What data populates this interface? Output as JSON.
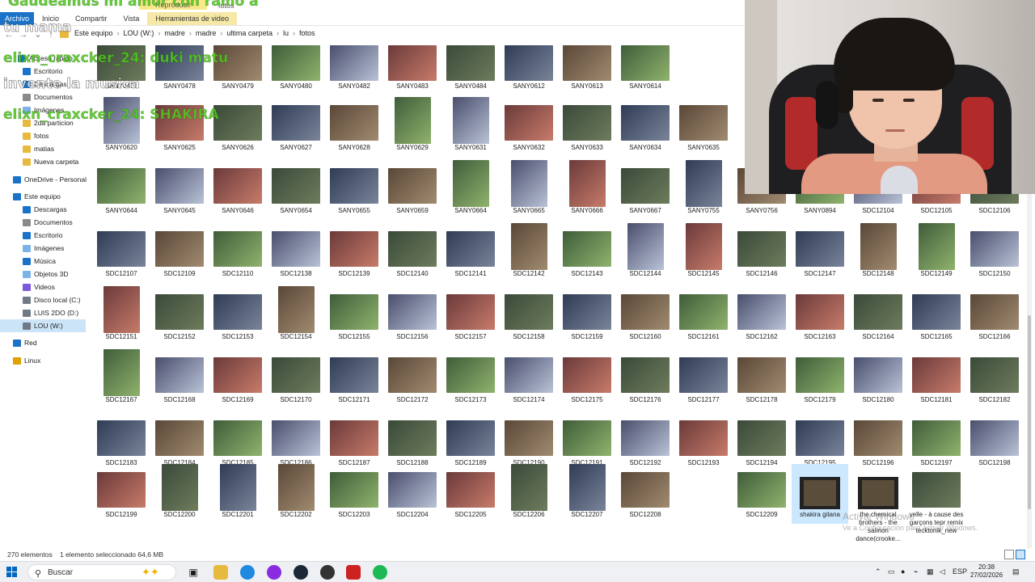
{
  "ribbon": {
    "tabs": [
      "Archivo",
      "Inicio",
      "Compartir",
      "Vista",
      "Herramientas de video"
    ],
    "context_label": "Reproducir",
    "folder_title": "fotos"
  },
  "breadcrumb": [
    "Este equipo",
    "LOU (W:)",
    "madre",
    "madre",
    "ultima carpeta",
    "lu",
    "fotos"
  ],
  "sidebar": {
    "items": [
      {
        "label": "Acceso rápido",
        "color": "#1a73c8"
      },
      {
        "label": "Escritorio",
        "color": "#1a73c8"
      },
      {
        "label": "Descargas",
        "color": "#1a73c8"
      },
      {
        "label": "Documentos",
        "color": "#8a8a8a"
      },
      {
        "label": "Imágenes",
        "color": "#7db2e6"
      },
      {
        "label": "2da particion",
        "color": "#e7b93e"
      },
      {
        "label": "fotos",
        "color": "#e7b93e"
      },
      {
        "label": "matias",
        "color": "#e7b93e"
      },
      {
        "label": "Nueva carpeta",
        "color": "#e7b93e"
      },
      {
        "label": "OneDrive - Personal",
        "color": "#1a73c8"
      },
      {
        "label": "Este equipo",
        "color": "#1a73c8"
      },
      {
        "label": "Descargas",
        "color": "#1a73c8"
      },
      {
        "label": "Documentos",
        "color": "#8a8a8a"
      },
      {
        "label": "Escritorio",
        "color": "#1a73c8"
      },
      {
        "label": "Imágenes",
        "color": "#7db2e6"
      },
      {
        "label": "Música",
        "color": "#1a73c8"
      },
      {
        "label": "Objetos 3D",
        "color": "#7db2e6"
      },
      {
        "label": "Videos",
        "color": "#7d5ad9"
      },
      {
        "label": "Disco local (C:)",
        "color": "#6f7a86"
      },
      {
        "label": "LUIS 2DO (D:)",
        "color": "#6f7a86"
      },
      {
        "label": "LOU (W:)",
        "color": "#6f7a86"
      },
      {
        "label": "Red",
        "color": "#1a73c8"
      },
      {
        "label": "Linux",
        "color": "#e0a100"
      }
    ],
    "selected": "LOU (W:)"
  },
  "files": [
    "SANY0477",
    "SANY0478",
    "SANY0479",
    "SANY0480",
    "SANY0482",
    "SANY0483",
    "SANY0484",
    "SANY0612",
    "SANY0613",
    "SANY0614",
    "SANY0620",
    "SANY0625",
    "SANY0626",
    "SANY0627",
    "SANY0628",
    "SANY0629",
    "SANY0631",
    "SANY0632",
    "SANY0633",
    "SANY0634",
    "SANY0635",
    "SANY0644",
    "SANY0645",
    "SANY0646",
    "SANY0654",
    "SANY0655",
    "SANY0659",
    "SANY0664",
    "SANY0665",
    "SANY0666",
    "SANY0667",
    "SANY0755",
    "SANY0756",
    "SANY0894",
    "SDC12104",
    "SDC12105",
    "SDC12106",
    "SDC12107",
    "SDC12109",
    "SDC12110",
    "SDC12138",
    "SDC12139",
    "SDC12140",
    "SDC12141",
    "SDC12142",
    "SDC12143",
    "SDC12144",
    "SDC12145",
    "SDC12146",
    "SDC12147",
    "SDC12148",
    "SDC12149",
    "SDC12150",
    "SDC12151",
    "SDC12152",
    "SDC12153",
    "SDC12154",
    "SDC12155",
    "SDC12156",
    "SDC12157",
    "SDC12158",
    "SDC12159",
    "SDC12160",
    "SDC12161",
    "SDC12162",
    "SDC12163",
    "SDC12164",
    "SDC12165",
    "SDC12166",
    "SDC12167",
    "SDC12168",
    "SDC12169",
    "SDC12170",
    "SDC12171",
    "SDC12172",
    "SDC12173",
    "SDC12174",
    "SDC12175",
    "SDC12176",
    "SDC12177",
    "SDC12178",
    "SDC12179",
    "SDC12180",
    "SDC12181",
    "SDC12182",
    "SDC12183",
    "SDC12184",
    "SDC12185",
    "SDC12186",
    "SDC12187",
    "SDC12188",
    "SDC12189",
    "SDC12190",
    "SDC12191",
    "SDC12192",
    "SDC12193",
    "SDC12194",
    "SDC12195",
    "SDC12196",
    "SDC12197",
    "SDC12198",
    "SDC12199",
    "SDC12200",
    "SDC12201",
    "SDC12202",
    "SDC12203",
    "SDC12204",
    "SDC12205",
    "SDC12206",
    "SDC12207",
    "SDC12208",
    "SDC12209",
    "shakira gitana",
    "the chemical brothers - the salmon dance(crooke...",
    "yelle - à cause des garçons tepr remix tecktonik_new"
  ],
  "selected_file": "shakira gitana",
  "hover_file": "SANY0654",
  "status": {
    "count": "270 elementos",
    "selection": "1 elemento seleccionado  64,6 MB"
  },
  "taskbar": {
    "search_label": "Buscar",
    "lang": "ESP",
    "time": "20:38",
    "date": "27/02/2026"
  },
  "watermark": {
    "title": "Activar Windows",
    "subtitle": "Ve a Configuración para activar Windows."
  },
  "chat": {
    "line1": "Gaudeamus mi amor con ramo a",
    "line2": "tu mama",
    "line3": "elixn_craxcker_24: duki matu",
    "line4": "invente la musica",
    "line5": "elixn_craxcker_24: SHAKIRA"
  },
  "colors": {
    "accent": "#1a73c8",
    "selection": "#cce8ff",
    "chat_green": "#50c81e"
  }
}
